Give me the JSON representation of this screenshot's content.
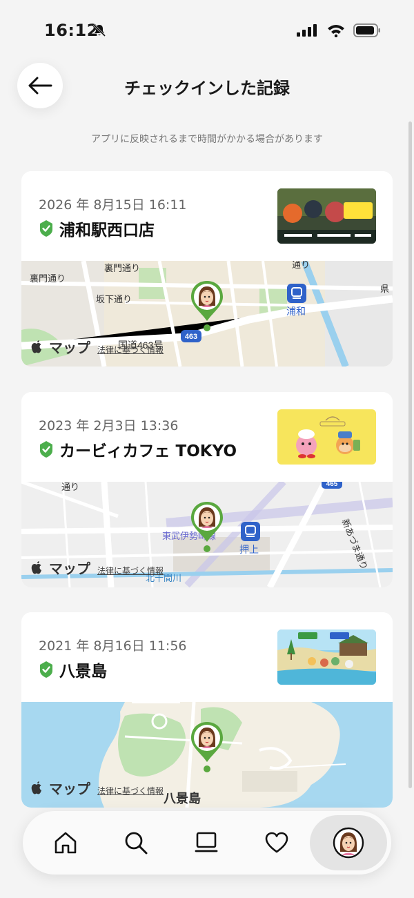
{
  "status": {
    "time": "16:12"
  },
  "header": {
    "title": "チェックインした記録"
  },
  "notice": "アプリに反映されるまで時間がかかる場合があります",
  "checkins": [
    {
      "date": "2026 年 8月15日 16:11",
      "place": "浦和駅西口店",
      "map": {
        "labels": [
          "裏門通り",
          "裏門通り",
          "坂下通り",
          "国道463号",
          "浦和",
          "県",
          "通り"
        ],
        "route_badge": "463",
        "colors": {
          "base": "#f0ead9",
          "road": "#ffffff",
          "water": "#9ad0ee",
          "park": "#bfe2b2"
        }
      }
    },
    {
      "date": "2023 年 2月3日 13:36",
      "place": "カービィカフェ TOKYO",
      "map": {
        "labels": [
          "通り",
          "東武伊勢崎線",
          "押上",
          "北十間川",
          "新あづま通り"
        ],
        "route_badge": "465",
        "colors": {
          "base": "#efefef",
          "road": "#ffffff",
          "water": "#9ad0ee",
          "park": "#e0dcd6"
        }
      }
    },
    {
      "date": "2021 年 8月16日 11:56",
      "place": "八景島",
      "map": {
        "labels": [
          "八景島"
        ],
        "colors": {
          "base": "#a7d8f0",
          "island": "#f3efe4",
          "park": "#bfe2b2"
        }
      }
    }
  ],
  "map_credit": {
    "brand": "マップ",
    "legal": "法律に基づく情報"
  },
  "tabs": [
    {
      "icon": "home-icon"
    },
    {
      "icon": "search-icon"
    },
    {
      "icon": "screen-icon"
    },
    {
      "icon": "heart-icon"
    },
    {
      "icon": "profile-avatar-icon"
    }
  ],
  "colors": {
    "check": "#4cae4c",
    "pin": "#5aa83f"
  }
}
